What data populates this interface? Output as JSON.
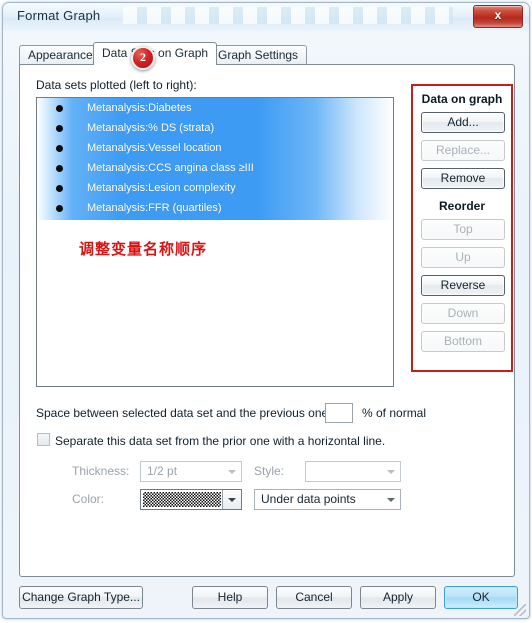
{
  "window": {
    "title": "Format Graph",
    "close_label": "x"
  },
  "annotation": {
    "step_badge": "2",
    "note_cn": "调整变量名称顺序",
    "accent_red": "#c02020",
    "note_color": "#d81414"
  },
  "tabs": [
    {
      "label": "Appearance",
      "active": false
    },
    {
      "label": "Data Sets on Graph",
      "active": true
    },
    {
      "label": "Graph Settings",
      "active": false
    }
  ],
  "datasets": {
    "list_label": "Data sets plotted (left to right):",
    "items": [
      {
        "label": "Metanalysis:Diabetes",
        "selected": true
      },
      {
        "label": "Metanalysis:% DS (strata)",
        "selected": true
      },
      {
        "label": "Metanalysis:Vessel location",
        "selected": true
      },
      {
        "label": "Metanalysis:CCS angina class ≥III",
        "selected": true
      },
      {
        "label": "Metanalysis:Lesion complexity",
        "selected": true
      },
      {
        "label": "Metanalysis:FFR (quartiles)",
        "selected": true
      }
    ],
    "selection_color": "#3d9bf4",
    "bullet_icon": "bullet-dot-icon"
  },
  "data_on_graph": {
    "title": "Data on graph",
    "buttons": [
      {
        "label": "Add...",
        "enabled": true
      },
      {
        "label": "Replace...",
        "enabled": false
      },
      {
        "label": "Remove",
        "enabled": true
      }
    ],
    "reorder_title": "Reorder",
    "reorder_buttons": [
      {
        "label": "Top",
        "enabled": false
      },
      {
        "label": "Up",
        "enabled": false
      },
      {
        "label": "Reverse",
        "enabled": true
      },
      {
        "label": "Down",
        "enabled": false
      },
      {
        "label": "Bottom",
        "enabled": false
      }
    ]
  },
  "spacing": {
    "label": "Space between selected data set and the previous one:",
    "value": "",
    "placeholder": "",
    "suffix": "%  of normal"
  },
  "separator": {
    "checkbox_label": "Separate this data set from the prior one with a horizontal line.",
    "checked": false,
    "thickness_label": "Thickness:",
    "thickness_value": "1/2 pt",
    "style_label": "Style:",
    "style_value": "",
    "color_label": "Color:",
    "color_value": "",
    "position_value": "Under data points"
  },
  "footer": {
    "change_graph_type": "Change Graph Type...",
    "help": "Help",
    "cancel": "Cancel",
    "apply": "Apply",
    "ok": "OK"
  }
}
